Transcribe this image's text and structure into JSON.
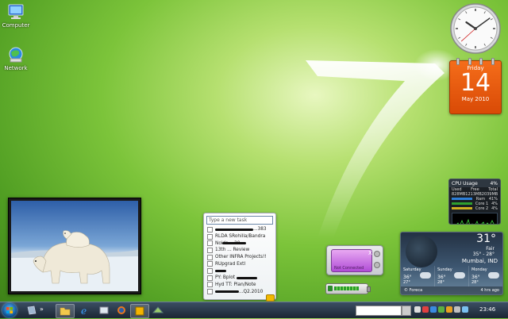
{
  "desktop": {
    "icons": [
      {
        "label": "Computer",
        "icon": "computer-icon"
      },
      {
        "label": "Network",
        "icon": "network-icon"
      }
    ],
    "wallpaper": "windows-7-green"
  },
  "calendar": {
    "day_name": "Friday",
    "date": "14",
    "month_year": "May 2010"
  },
  "clock": {
    "hour": 10,
    "minute": 9,
    "second": 38
  },
  "cpu_meter": {
    "title": "CPU Usage",
    "usage": "4%",
    "headers": [
      "Used",
      "Free",
      "Total"
    ],
    "values": [
      "828MB",
      "1213MB",
      "2039MB"
    ],
    "ram_label": "Ram",
    "ram_value": "41%",
    "core1_label": "Core 1",
    "core1_value": "4%",
    "core2_label": "Core 2",
    "core2_value": "4%"
  },
  "weather": {
    "temp": "31°",
    "condition": "Fair",
    "range": "35° - 28°",
    "city": "Mumbai, IND",
    "forecast": [
      {
        "day": "Saturday",
        "high": "36°",
        "low": "27°"
      },
      {
        "day": "Sunday",
        "high": "36°",
        "low": "28°"
      },
      {
        "day": "Monday",
        "high": "36°",
        "low": "28°"
      }
    ],
    "provider": "© Foreca",
    "updated": "4 hrs ago"
  },
  "notes": {
    "placeholder": "Type a new task",
    "tasks": [
      "...383",
      "RLDA SRohilla/Bandra",
      "Noida ...20",
      "13th ... Review",
      "Other INFRA Projects!!",
      "RUpgrad Extl",
      "",
      "PY: Bplot",
      "Hyd TT: Plan/Note",
      "...Q2.2010"
    ]
  },
  "network": {
    "status": "Not Connected",
    "close_glyph": "X"
  },
  "battery": {
    "level": 0.85
  },
  "taskbar": {
    "overflow_glyph": "»",
    "time": "23:46"
  }
}
